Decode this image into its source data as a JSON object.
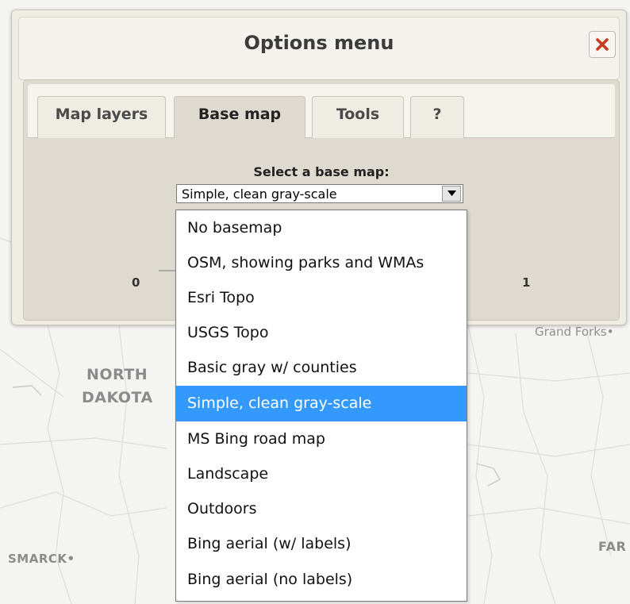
{
  "map": {
    "labels": {
      "north": "NORTH",
      "dakota": "DAKOTA",
      "grand_forks": "Grand Forks•",
      "bismarck": "SMARCK•",
      "fargo": "FAR"
    }
  },
  "dialog": {
    "title": "Options menu",
    "close_icon": "close-x-icon",
    "accent_color": "#c8391c",
    "tabs": [
      {
        "label": "Map layers",
        "active": false
      },
      {
        "label": "Base map",
        "active": true
      },
      {
        "label": "Tools",
        "active": false
      },
      {
        "label": "?",
        "active": false
      }
    ],
    "base_map": {
      "label": "Select a base map:",
      "selected": "Simple, clean gray-scale",
      "slider_min": "0",
      "slider_max": "1",
      "options": [
        "No basemap",
        "OSM, showing parks and WMAs",
        "Esri Topo",
        "USGS Topo",
        "Basic gray w/ counties",
        "Simple, clean gray-scale",
        "MS Bing road map",
        "Landscape",
        "Outdoors",
        "Bing aerial (w/ labels)",
        "Bing aerial (no labels)"
      ],
      "highlight_color": "#3399ff"
    }
  }
}
